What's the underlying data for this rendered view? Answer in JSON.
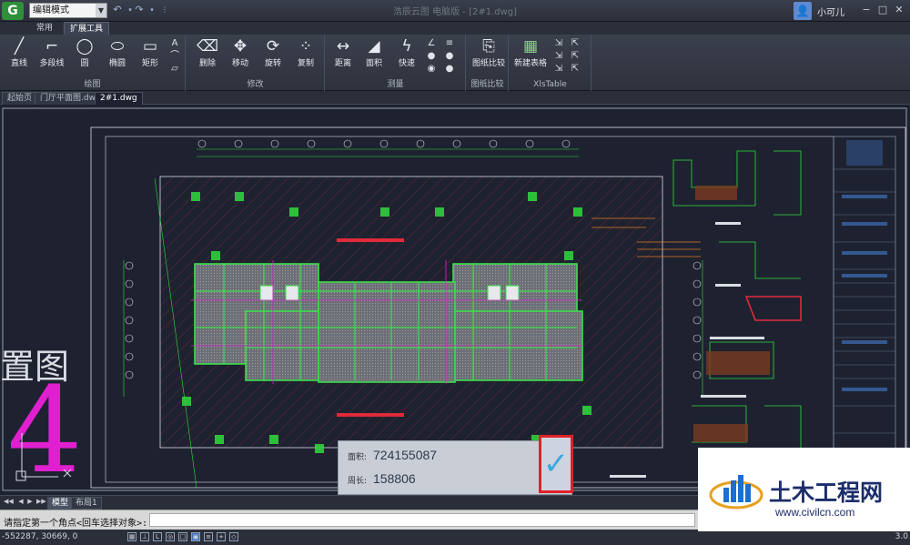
{
  "app": {
    "title": "浩辰云图 电脑版 - [2#1.dwg]",
    "logo_glyph": "G",
    "mode_select": "编辑模式",
    "user_name": "小可儿"
  },
  "ribbon_tabs": [
    "常用",
    "扩展工具"
  ],
  "ribbon_active_tab": 1,
  "ribbon_groups": {
    "draw": {
      "label": "绘图",
      "buttons": [
        "直线",
        "多段线",
        "圆",
        "椭圆",
        "矩形"
      ]
    },
    "modify": {
      "label": "修改",
      "buttons": [
        "删除",
        "移动",
        "旋转",
        "复制"
      ]
    },
    "measure": {
      "label": "测量",
      "buttons": [
        "距离",
        "面积",
        "快速"
      ]
    },
    "compare": {
      "label": "图纸比较",
      "buttons": [
        "图纸比较"
      ]
    },
    "xlstable": {
      "label": "XlsTable",
      "buttons": [
        "新建表格"
      ]
    }
  },
  "doc_tabs": [
    "起始页",
    "门厅平面图.dwg",
    "2#1.dwg"
  ],
  "doc_active_tab": 2,
  "measure": {
    "area_label": "面积:",
    "area_value": "724155087",
    "perimeter_label": "周长:",
    "perimeter_value": "158806"
  },
  "canvas_text": {
    "partial_title": "置图",
    "big_numeral": "4"
  },
  "layout_tabs": [
    "模型",
    "布局1"
  ],
  "layout_active_tab": 0,
  "command_prompt": "请指定第一个角点<回车选择对象>:",
  "status": {
    "coords": "-552287, 30669, 0",
    "version": "3.0"
  },
  "watermark": {
    "title": "土木工程网",
    "url": "www.civilcn.com"
  },
  "colors": {
    "canvas_bg": "#1e2230",
    "accent_green": "#39e04a",
    "accent_magenta": "#e020d0",
    "confirm_border": "#e0202a",
    "confirm_check": "#3fa8dd"
  }
}
